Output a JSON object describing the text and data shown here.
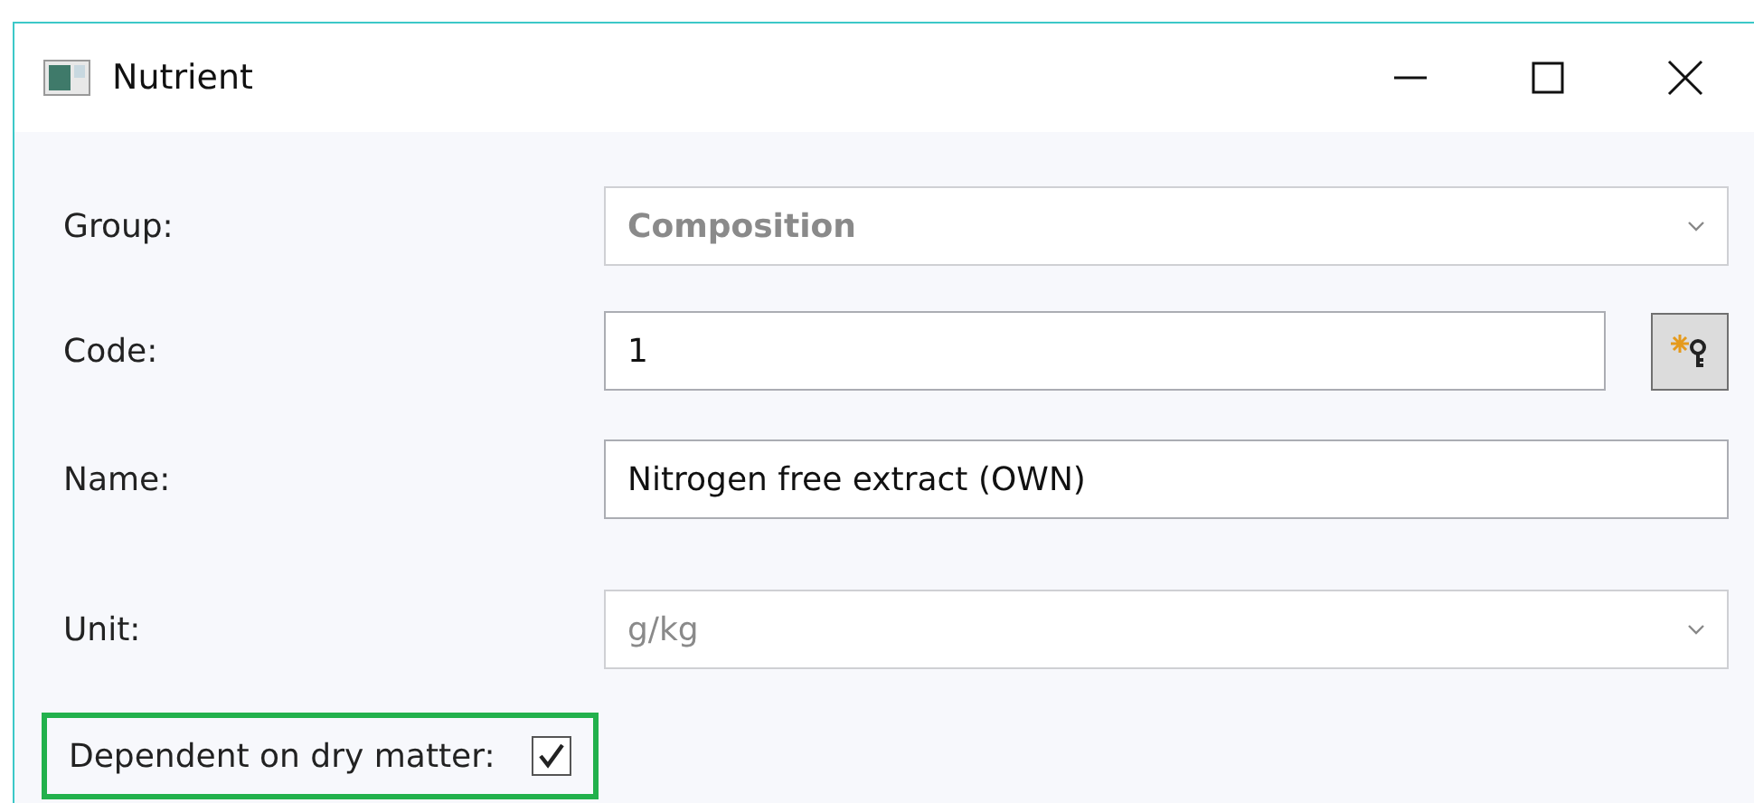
{
  "window": {
    "title": "Nutrient"
  },
  "fields": [
    {
      "kind": "dropdown",
      "label": "Group:",
      "value": "Composition",
      "disabled": true,
      "bold": true
    },
    {
      "kind": "text_with_button",
      "label": "Code:",
      "value": "1",
      "disabled": false
    },
    {
      "kind": "text",
      "label": "Name:",
      "value": "Nitrogen free extract (OWN)",
      "disabled": false
    },
    {
      "kind": "dropdown",
      "label": "Unit:",
      "value": "g/kg",
      "disabled": true,
      "bold": false
    }
  ],
  "checkbox": {
    "label": "Dependent on dry matter:",
    "checked": true,
    "highlighted": true
  }
}
